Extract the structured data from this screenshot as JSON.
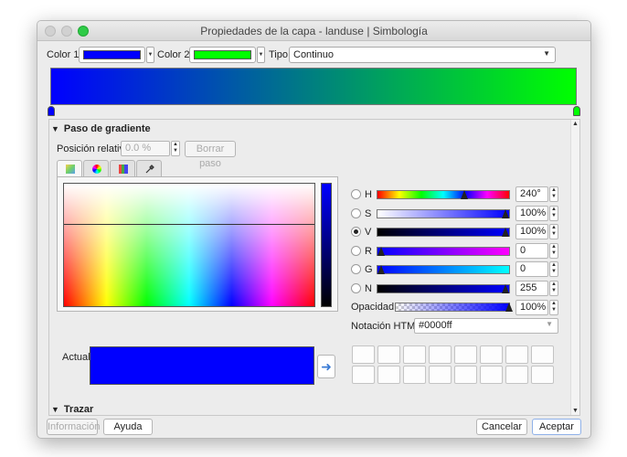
{
  "window": {
    "title": "Propiedades de la capa - landuse | Simbología"
  },
  "top": {
    "color1_label": "Color 1",
    "color2_label": "Color 2",
    "color1": "#0000ff",
    "color2": "#00ff00",
    "tipo_label": "Tipo",
    "tipo_value": "Continuo"
  },
  "gradient_stop": {
    "section_title": "Paso de gradiente",
    "posicion_label": "Posición relativa",
    "posicion_value": "0.0 %",
    "borrar_label": "Borrar paso"
  },
  "picker": {
    "tabs": [
      "color-square",
      "color-wheel",
      "swatch-grid",
      "eyedropper"
    ],
    "actual_label": "Actual",
    "actual_color": "#0000ff",
    "channels": [
      {
        "key": "H",
        "label": "H",
        "value": "240°",
        "level": 0.667
      },
      {
        "key": "S",
        "label": "S",
        "value": "100%",
        "level": 1.0
      },
      {
        "key": "V",
        "label": "V",
        "value": "100%",
        "level": 1.0,
        "selected": true
      },
      {
        "key": "R",
        "label": "R",
        "value": "0",
        "level": 0.0
      },
      {
        "key": "G",
        "label": "G",
        "value": "0",
        "level": 0.0
      },
      {
        "key": "N",
        "label": "N",
        "value": "255",
        "level": 1.0
      }
    ],
    "opacidad_label": "Opacidad",
    "opacidad_value": "100%",
    "html_label": "Notación HTML",
    "html_value": "#0000ff"
  },
  "trazar": {
    "section_title": "Trazar"
  },
  "footer": {
    "info_label": "Información",
    "ayuda_label": "Ayuda",
    "cancel_label": "Cancelar",
    "accept_label": "Aceptar"
  }
}
